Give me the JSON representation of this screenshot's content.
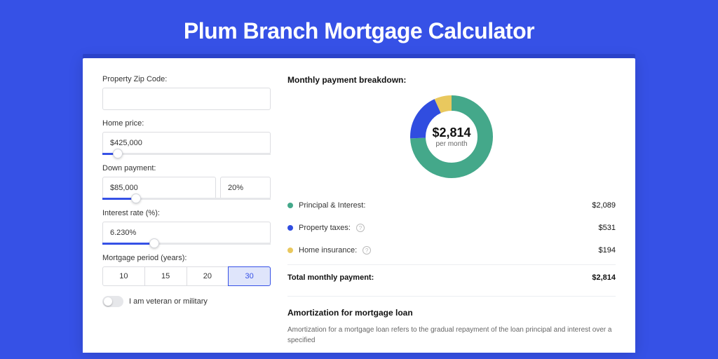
{
  "title": "Plum Branch Mortgage Calculator",
  "form": {
    "zip_label": "Property Zip Code:",
    "zip_value": "",
    "price_label": "Home price:",
    "price_value": "$425,000",
    "price_slider_pct": 9,
    "down_label": "Down payment:",
    "down_value": "$85,000",
    "down_pct": "20%",
    "down_slider_pct": 20,
    "rate_label": "Interest rate (%):",
    "rate_value": "6.230%",
    "rate_slider_pct": 31,
    "period_label": "Mortgage period (years):",
    "periods": [
      "10",
      "15",
      "20",
      "30"
    ],
    "period_selected": "30",
    "veteran_label": "I am veteran or military"
  },
  "breakdown": {
    "title": "Monthly payment breakdown:",
    "total_value": "$2,814",
    "total_sub": "per month",
    "rows": [
      {
        "label": "Principal & Interest:",
        "value": "$2,089",
        "color": "#44a88a",
        "help": false
      },
      {
        "label": "Property taxes:",
        "value": "$531",
        "color": "#304de0",
        "help": true
      },
      {
        "label": "Home insurance:",
        "value": "$194",
        "color": "#e9c85e",
        "help": true
      }
    ],
    "total_label": "Total monthly payment:",
    "total_row_value": "$2,814"
  },
  "chart_data": {
    "type": "pie",
    "title": "Monthly payment breakdown",
    "series": [
      {
        "name": "Principal & Interest",
        "value": 2089,
        "color": "#44a88a"
      },
      {
        "name": "Property taxes",
        "value": 531,
        "color": "#304de0"
      },
      {
        "name": "Home insurance",
        "value": 194,
        "color": "#e9c85e"
      }
    ],
    "total": 2814
  },
  "amort": {
    "title": "Amortization for mortgage loan",
    "body": "Amortization for a mortgage loan refers to the gradual repayment of the loan principal and interest over a specified"
  }
}
